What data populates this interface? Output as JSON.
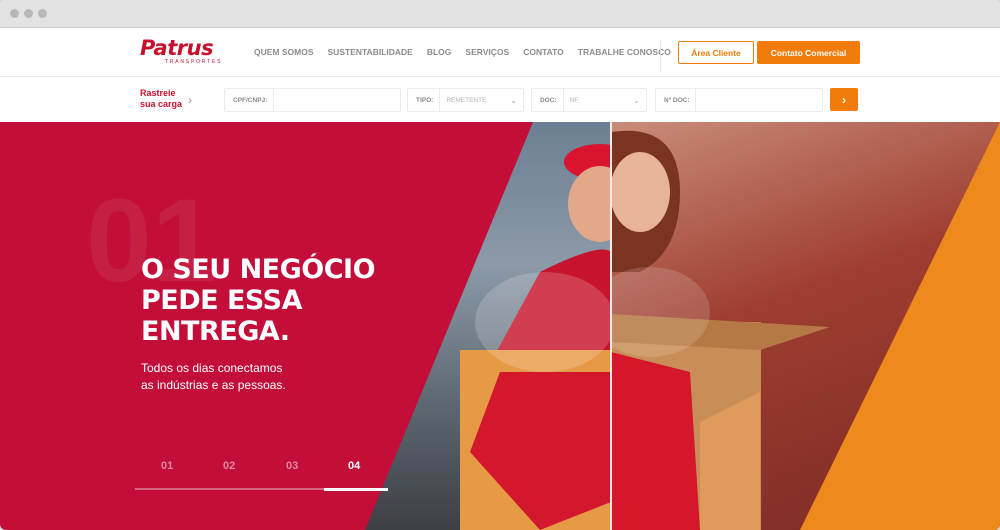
{
  "header": {
    "logo": {
      "name": "Patrus",
      "tagline": "TRANSPORTES"
    },
    "nav": [
      "QUEM SOMOS",
      "SUSTENTABILIDADE",
      "BLOG",
      "SERVIÇOS",
      "CONTATO",
      "TRABALHE CONOSCO"
    ],
    "area_cliente": "Área Cliente",
    "contato_comercial": "Contato Comercial"
  },
  "tracking": {
    "title": "Rastreie sua carga",
    "cpf_label": "CPF/CNPJ:",
    "cpf_value": "",
    "tipo_label": "TIPO:",
    "tipo_value": "REMETENTE",
    "doc_label": "DOC:",
    "doc_value": "NF",
    "ndoc_label": "Nº DOC:",
    "ndoc_value": ""
  },
  "hero": {
    "big_number": "01",
    "headline": "O SEU NEGÓCIO\nPEDE ESSA\nENTREGA.",
    "subtext": "Todos os dias conectamos\nas indústrias e as pessoas.",
    "slides": [
      "01",
      "02",
      "03",
      "04"
    ],
    "active_slide": "04",
    "progress": 0.25
  },
  "colors": {
    "brand_red": "#c20e39",
    "brand_orange": "#f07d0b"
  }
}
